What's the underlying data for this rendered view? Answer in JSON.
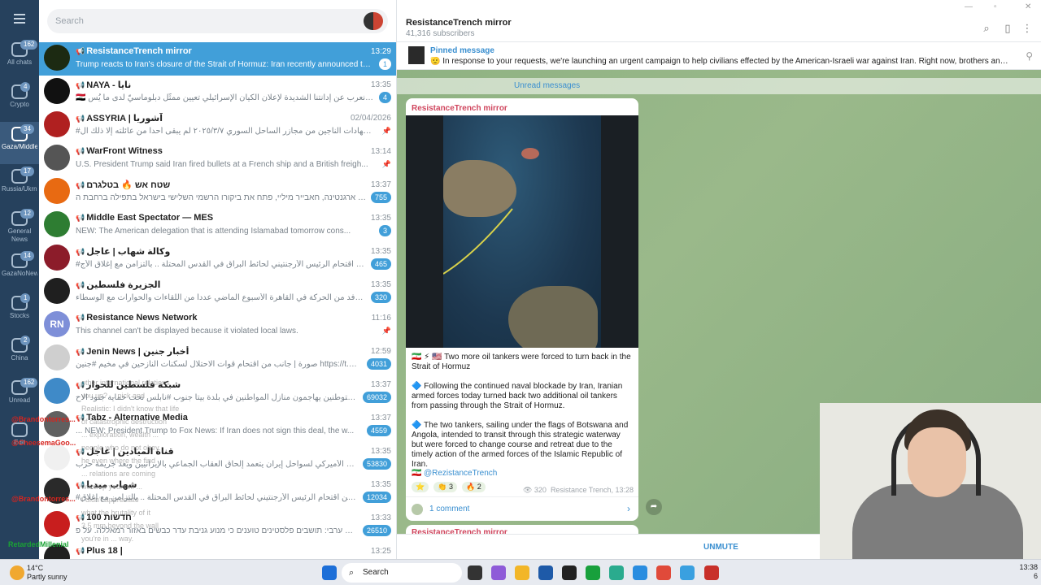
{
  "rail": {
    "folders": [
      {
        "label": "All chats",
        "badge": "162"
      },
      {
        "label": "Crypto",
        "badge": "4"
      },
      {
        "label": "Gaza/MiddleE",
        "badge": "34"
      },
      {
        "label": "Russia/Ukrne",
        "badge": "17"
      },
      {
        "label": "General News",
        "badge": "12"
      },
      {
        "label": "GazaNoNews",
        "badge": "14"
      },
      {
        "label": "Stocks",
        "badge": "1"
      },
      {
        "label": "China",
        "badge": "2"
      },
      {
        "label": "Unread",
        "badge": "162"
      },
      {
        "label": "Edit",
        "badge": ""
      }
    ]
  },
  "search": {
    "placeholder": "Search"
  },
  "chats": [
    {
      "name": "ResistanceTrench mirror",
      "time": "13:29",
      "preview": "Trump reacts to Iran's closure of the Strait of Hormuz: Iran recently announced that they we...",
      "badge": "1",
      "color": "#1c2a12",
      "initials": "",
      "active": true
    },
    {
      "name": "NAYA - نايا",
      "time": "13:35",
      "preview": "🇮🇶 وزارة الخارجية العراقية: نعرب عن إدانتنا الشديدة لإعلان الكيان الإسرائيلي تعيين ممثّل دبلوماسيّ لدى ما يُس...",
      "badge": "4",
      "color": "#111111",
      "initials": "",
      "active": false
    },
    {
      "name": "ASSYRIA | آشوريا",
      "time": "02/04/2026",
      "preview": "#مجازر_آذار شهادات الناجين من مجازر الساحل السوري ٢٠٢٥/٣/٧ لم يبقى أحداً من عائلته إلا ذلك ال...",
      "badge": "",
      "color": "#b02020",
      "initials": "",
      "active": false
    },
    {
      "name": "WarFront Witness",
      "time": "13:14",
      "preview": "U.S. President Trump said Iran fired bullets at a French ship and a British freigh...",
      "badge": "",
      "color": "#555555",
      "initials": "",
      "active": false
    },
    {
      "name": "שטח אש 🔥 בטלגרם",
      "time": "13:37",
      "preview": "נשיא ארגנטינה, חאבייר מיליי, פתח את ביקורו הרשמי השלישי בישראל בתפילה ברחבת ה...",
      "badge": "755",
      "color": "#e86a12",
      "initials": "",
      "active": false
    },
    {
      "name": "Middle East Spectator — MES",
      "time": "13:35",
      "preview": "NEW: The American delegation that is attending Islamabad tomorrow cons...",
      "badge": "3",
      "color": "#2e7d32",
      "initials": "",
      "active": false
    },
    {
      "name": "وكالة شهاب | عاجل",
      "time": "13:35",
      "preview": "#صور | من اقتحام الرئيس الأرجنتيني لحائط البراق في القدس المحتلة .. بالتزامن مع إغلاق الأج...",
      "badge": "465",
      "color": "#8c1c2a",
      "initials": "",
      "active": false
    },
    {
      "name": "الجزيرة فلسطين",
      "time": "13:35",
      "preview": "حركة حمـــاس: عقد وفد من الحركة في القاهرة الأسبوع الماضي عدداً من اللقاءات والحوارات مع الوسطاء...",
      "badge": "320",
      "color": "#1f1f1f",
      "initials": "",
      "active": false
    },
    {
      "name": "Resistance News Network",
      "time": "11:16",
      "preview": "This channel can't be displayed because it violated local laws.",
      "badge": "",
      "color": "#7e8fd8",
      "initials": "RN",
      "active": false
    },
    {
      "name": "Jenin News | أخبار جنين",
      "time": "12:59",
      "preview": "صورة | جانب من اقتحام قوات الاحتلال لسكنات النازحين في مخيم #جنين  https://t.me/jeninnews1",
      "badge": "4031",
      "color": "#cfcfcf",
      "initials": "",
      "active": false
    },
    {
      "name": "شبكة فلسطين للحوار",
      "time": "13:37",
      "preview": "قطعان المستوطنين يهاجمون منازل المواطنين في بلدة بيتا جنوب #نابلس تحت حماية جنود الاح...",
      "badge": "69032",
      "color": "#3f8ac8",
      "initials": "",
      "active": false
    },
    {
      "name": "Tabz - Alternative Media",
      "time": "13:37",
      "preview": "... NEW: President Trump to Fox News: If Iran does not sign this deal, the w...",
      "badge": "4559",
      "color": "#606060",
      "initials": "",
      "active": false
    },
    {
      "name": "قناة الميادين | عاجل",
      "time": "13:35",
      "preview": "إيران: بقائي: الحصار الأميركي لسواحل إيران يتعمد إلحاق العقاب الجماعي بالإيرانيين ويعد جريمة حرب ...",
      "badge": "53830",
      "color": "#f0f0f0",
      "initials": "",
      "active": false
    },
    {
      "name": "شهاب ميديا",
      "time": "13:35",
      "preview": "#صور | من اقتحام الرئيس الأرجنتيني لحائط البراق في القدس المحتلة .. بالتزامن مع إغلاق ...",
      "badge": "12034",
      "color": "#2a2a2a",
      "initials": "",
      "active": false
    },
    {
      "name": "חדשות 100",
      "time": "13:33",
      "preview": "דיווח ערבי: תושבים פלסטינים טוענים כי מנוע גניבת עדר כבשים באזור רמאללה. על פ...",
      "badge": "26510",
      "color": "#c81e1e",
      "initials": "",
      "active": false
    },
    {
      "name": "Plus 18 |",
      "time": "13:25",
      "preview": "",
      "badge": "",
      "color": "#202020",
      "initials": "",
      "active": false
    }
  ],
  "header": {
    "title": "ResistanceTrench mirror",
    "subtitle": "41,316 subscribers"
  },
  "pinned": {
    "label": "Pinned message",
    "text": "🫡 In response to your requests, we're launching an urgent campaign to help civilians effected by the American-Israeli war against Iran. Right now, brothers and sisters are on the..."
  },
  "unread_label": "Unread messages",
  "message": {
    "sender": "ResistanceTrench mirror",
    "p1": "🇮🇷 ⚡ 🇺🇸 Two more oil tankers were forced to turn back in the Strait of Hormuz",
    "p2": "🔷 Following the continued naval blockade by Iran, Iranian armed forces today turned back two additional oil tankers from passing through the Strait of Hormuz.",
    "p3": "🔷 The two tankers, sailing under the flags of Botswana and Angola, intended to transit through this strategic waterway but were forced to change course and retreat due to the timely action of the armed forces of the Islamic Republic of Iran.",
    "link": "@RezistanceTrench",
    "reactions": [
      {
        "emoji": "⭐",
        "count": ""
      },
      {
        "emoji": "👏",
        "count": "3"
      },
      {
        "emoji": "🔥",
        "count": "2"
      }
    ],
    "views": "320",
    "signature": "Resistance Trench, 13:28",
    "comments": "1 comment"
  },
  "message2_sender": "ResistanceTrench mirror",
  "footer": {
    "unmute": "UNMUTE"
  },
  "overlay": [
    {
      "text": "@Brandontorres...",
      "kind": "red"
    },
    {
      "text": "@CheesemaGoo...",
      "kind": "red"
    },
    {
      "text": "@Brandontorres...",
      "kind": "red"
    },
    {
      "text": "RetardedMillenial",
      "kind": "green"
    }
  ],
  "overlay_gray": [
    "other international relations",
    "you up? ... pick and",
    "Realistic: I didn't know that life",
    "of catastrophic destruction",
    "... exploration, wealth ...",
    "people who do not obey.",
    "he even where the find",
    "... relations are coming",
    "worship yourself ...",
    "I didn't appreciate",
    "what the brutality of it",
    "3.5 mm beyond the wall",
    "you're in ... way."
  ],
  "taskbar": {
    "temp": "14°C",
    "weather": "Partly sunny",
    "search": "Search",
    "time": "13:38",
    "date": "6"
  }
}
